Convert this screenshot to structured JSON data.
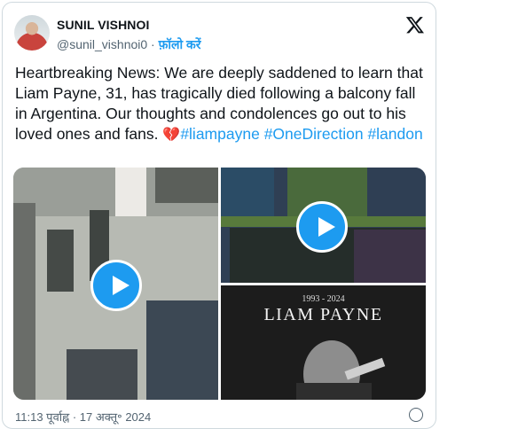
{
  "user": {
    "name": "SUNIL VISHNOI",
    "handle": "@sunil_vishnoi0",
    "separator": "·",
    "follow_label": "फ़ॉलो करें"
  },
  "tweet": {
    "text_main": "Heartbreaking News: We are deeply saddened to learn that Liam Payne, 31, has tragically died following a balcony fall in Argentina. Our thoughts and condolences go out to his loved ones and fans.",
    "heart_emoji": "💔",
    "hashtags": [
      "#liampayne",
      "#OneDirection",
      "#landon"
    ]
  },
  "media": {
    "memorial_years": "1993 - 2024",
    "memorial_name": "LIAM PAYNE",
    "play_icon": "play-icon"
  },
  "footer": {
    "timestamp": "11:13 पूर्वाह्न · 17 अक्तू॰ 2024"
  },
  "colors": {
    "accent": "#1d9bf0",
    "text": "#0f1419",
    "muted": "#536471",
    "border": "#cfd9de"
  }
}
